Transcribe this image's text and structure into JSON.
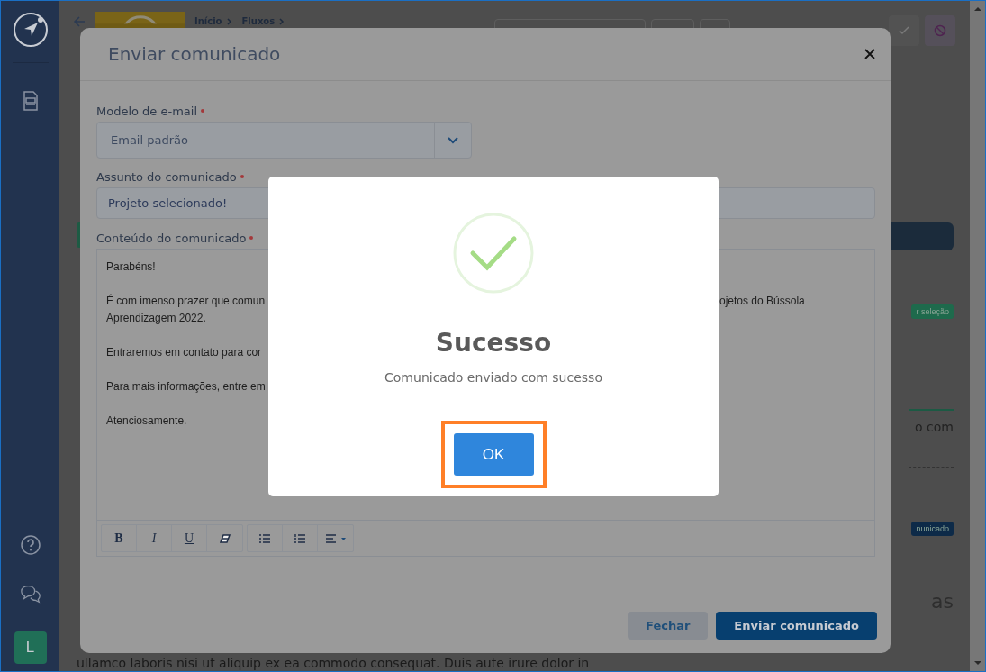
{
  "sidebar": {
    "avatar": "L"
  },
  "page": {
    "breadcrumb": [
      "Início",
      "Fluxos"
    ],
    "tags": [
      {
        "label": "r seleção",
        "color": "#1e6a4c"
      },
      {
        "label": "nunicado",
        "color": "#0d2a48"
      }
    ],
    "snippet": "o com",
    "heading": "as",
    "body_line": "ullamco laboris nisi ut aliquip ex ea commodo consequat. Duis aute irure dolor in"
  },
  "modal": {
    "title": "Enviar comunicado",
    "select": {
      "label": "Modelo de e-mail",
      "required": true,
      "value": "Email padrão"
    },
    "subject": {
      "label": "Assunto do comunicado",
      "required": true,
      "value": "Projeto selecionado!"
    },
    "content": {
      "label": "Conteúdo do comunicado",
      "required": true,
      "paragraphs": [
        {
          "lines": [
            {
              "left": "Parabéns!"
            }
          ]
        },
        {
          "lines": [
            {
              "left": "É com imenso prazer que comun",
              "right": "ojetos do Bússola"
            },
            {
              "left": "Aprendizagem 2022."
            }
          ]
        },
        {
          "lines": [
            {
              "left": "Entraremos em contato para cor"
            }
          ]
        },
        {
          "lines": [
            {
              "left": "Para mais informações, entre em"
            }
          ]
        },
        {
          "lines": [
            {
              "left": "Atenciosamente."
            }
          ]
        }
      ],
      "toolbar": [
        {
          "kind": "bold",
          "label": "B"
        },
        {
          "kind": "italic",
          "label": "I"
        },
        {
          "kind": "underline",
          "label": "U"
        },
        {
          "kind": "eraser"
        },
        {
          "kind": "bullets"
        },
        {
          "kind": "numbers"
        },
        {
          "kind": "align"
        }
      ]
    },
    "buttons": [
      {
        "label": "Fechar",
        "kind": "secondary"
      },
      {
        "label": "Enviar comunicado",
        "kind": "primary"
      }
    ]
  },
  "alert": {
    "title": "Sucesso",
    "message": "Comunicado enviado com sucesso",
    "button": "OK",
    "highlighted": true
  }
}
